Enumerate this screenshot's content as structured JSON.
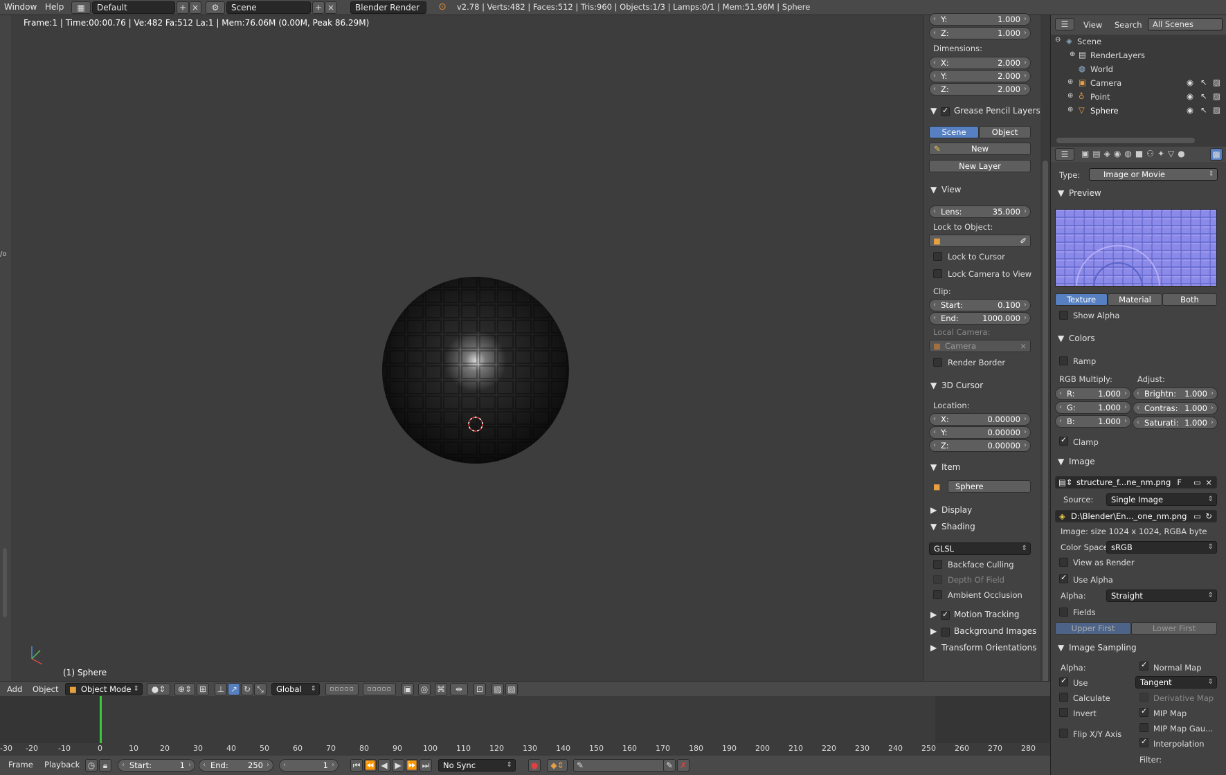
{
  "topbar": {
    "menu_window": "Window",
    "menu_help": "Help",
    "layout": "Default",
    "scene": "Scene",
    "engine": "Blender Render",
    "stats": "v2.78 | Verts:482 | Faces:512 | Tris:960 | Objects:1/3 | Lamps:0/1 | Mem:51.96M | Sphere"
  },
  "viewport": {
    "info": "Frame:1 | Time:00:00.76 | Ve:482 Fa:512 La:1 | Mem:76.06M (0.00M, Peak 86.29M)",
    "object_label": "(1) Sphere",
    "left_strip_text": "/o"
  },
  "npanel": {
    "scale_y_label": "Y:",
    "scale_y": "1.000",
    "scale_z_label": "Z:",
    "scale_z": "1.000",
    "dimensions": "Dimensions:",
    "dim_x_label": "X:",
    "dim_x": "2.000",
    "dim_y_label": "Y:",
    "dim_y": "2.000",
    "dim_z_label": "Z:",
    "dim_z": "2.000",
    "grease_pencil": "Grease Pencil Layers",
    "gp_scene": "Scene",
    "gp_object": "Object",
    "gp_new": "New",
    "gp_new_layer": "New Layer",
    "view": "View",
    "lens_label": "Lens:",
    "lens": "35.000",
    "lock_to_object": "Lock to Object:",
    "lock_to_cursor": "Lock to Cursor",
    "lock_camera": "Lock Camera to View",
    "clip": "Clip:",
    "clip_start_label": "Start:",
    "clip_start": "0.100",
    "clip_end_label": "End:",
    "clip_end": "1000.000",
    "local_camera": "Local Camera:",
    "camera": "Camera",
    "render_border": "Render Border",
    "cursor_3d": "3D Cursor",
    "location": "Location:",
    "cur_x_label": "X:",
    "cur_x": "0.00000",
    "cur_y_label": "Y:",
    "cur_y": "0.00000",
    "cur_z_label": "Z:",
    "cur_z": "0.00000",
    "item": "Item",
    "item_name": "Sphere",
    "display": "Display",
    "shading": "Shading",
    "shading_mode": "GLSL",
    "backface": "Backface Culling",
    "dof": "Depth Of Field",
    "ao": "Ambient Occlusion",
    "motion_tracking": "Motion Tracking",
    "background_images": "Background Images",
    "transform_orientations": "Transform Orientations"
  },
  "outliner": {
    "view": "View",
    "search": "Search",
    "filter": "All Scenes",
    "items": [
      "Scene",
      "RenderLayers",
      "World",
      "Camera",
      "Point",
      "Sphere"
    ]
  },
  "props": {
    "type_label": "Type:",
    "type_value": "Image or Movie",
    "preview": "Preview",
    "tab_texture": "Texture",
    "tab_material": "Material",
    "tab_both": "Both",
    "show_alpha": "Show Alpha",
    "colors": "Colors",
    "ramp": "Ramp",
    "rgb_multiply": "RGB Multiply:",
    "adjust": "Adjust:",
    "r_label": "R:",
    "r": "1.000",
    "g_label": "G:",
    "g": "1.000",
    "b_label": "B:",
    "b": "1.000",
    "bright_label": "Brightn:",
    "bright": "1.000",
    "contrast_label": "Contras:",
    "contrast": "1.000",
    "sat_label": "Saturati:",
    "sat": "1.000",
    "clamp": "Clamp",
    "image": "Image",
    "image_name": "structure_f...ne_nm.png",
    "image_f": "F",
    "source_label": "Source:",
    "source": "Single Image",
    "path": "D:\\Blender\\En..._one_nm.png",
    "image_size": "Image: size 1024 x 1024, RGBA byte",
    "colorspace_label": "Color Space:",
    "colorspace": "sRGB",
    "view_as_render": "View as Render",
    "use_alpha": "Use Alpha",
    "alpha_label": "Alpha:",
    "alpha": "Straight",
    "fields": "Fields",
    "upper_first": "Upper First",
    "lower_first": "Lower First",
    "image_sampling": "Image Sampling",
    "alpha2": "Alpha:",
    "normal_map": "Normal Map",
    "use": "Use",
    "tangent": "Tangent",
    "calculate": "Calculate",
    "derivative_map": "Derivative Map",
    "invert": "Invert",
    "mip_map": "MIP Map",
    "mip_map_gauss": "MIP Map Gau...",
    "flip_xy": "Flip X/Y Axis",
    "interpolation": "Interpolation",
    "filter": "Filter:"
  },
  "vp_header": {
    "add": "Add",
    "object": "Object",
    "mode": "Object Mode",
    "orientation": "Global"
  },
  "timeline": {
    "ticks": [
      "-30",
      "-20",
      "-10",
      "0",
      "10",
      "20",
      "30",
      "40",
      "50",
      "60",
      "70",
      "80",
      "90",
      "100",
      "110",
      "120",
      "130",
      "140",
      "150",
      "160",
      "170",
      "180",
      "190",
      "200",
      "210",
      "220",
      "230",
      "240",
      "250",
      "260",
      "270",
      "280"
    ],
    "frame": "Frame",
    "playback": "Playback",
    "start_label": "Start:",
    "start": "1",
    "end_label": "End:",
    "end": "250",
    "current": "1",
    "sync": "No Sync"
  },
  "colors": {
    "accent": "#5680c2",
    "playhead": "#3cc83c"
  }
}
